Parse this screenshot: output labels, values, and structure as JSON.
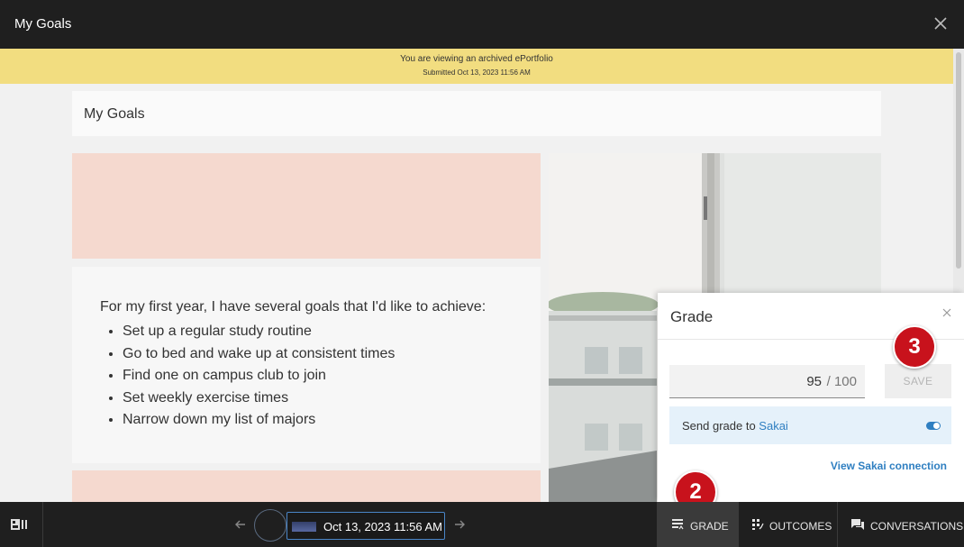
{
  "window": {
    "title": "My Goals"
  },
  "banner": {
    "line1": "You are viewing an archived ePortfolio",
    "line2": "Submitted Oct 13, 2023 11:56 AM",
    "color": "#f2dd80"
  },
  "page": {
    "title": "My Goals",
    "intro": "For my first year, I have several goals that I'd like to achieve:",
    "goals": [
      "Set up a regular study routine",
      "Go to bed and wake up at consistent times",
      "Find one on campus club to join",
      "Set weekly exercise times",
      "Narrow down my list of majors"
    ]
  },
  "grade_panel": {
    "title": "Grade",
    "score": "95",
    "max": "/ 100",
    "save_label": "SAVE",
    "sync_prefix": "Send grade to ",
    "sync_target": "Sakai",
    "sync_enabled": true,
    "link_label": "View Sakai connection"
  },
  "badges": {
    "grade_step": "2",
    "save_step": "3"
  },
  "bottom_bar": {
    "timestamp": "Oct 13, 2023 11:56 AM",
    "tabs": [
      {
        "label": "GRADE",
        "icon": "grade-icon",
        "active": true
      },
      {
        "label": "OUTCOMES",
        "icon": "outcomes-icon",
        "active": false
      },
      {
        "label": "CONVERSATIONS",
        "icon": "conversations-icon",
        "active": false
      }
    ]
  },
  "colors": {
    "accent": "#2f7fc1",
    "badge": "#c8121c",
    "pink_block": "#f5d9cf",
    "dark_bar": "#1f1f1f"
  }
}
